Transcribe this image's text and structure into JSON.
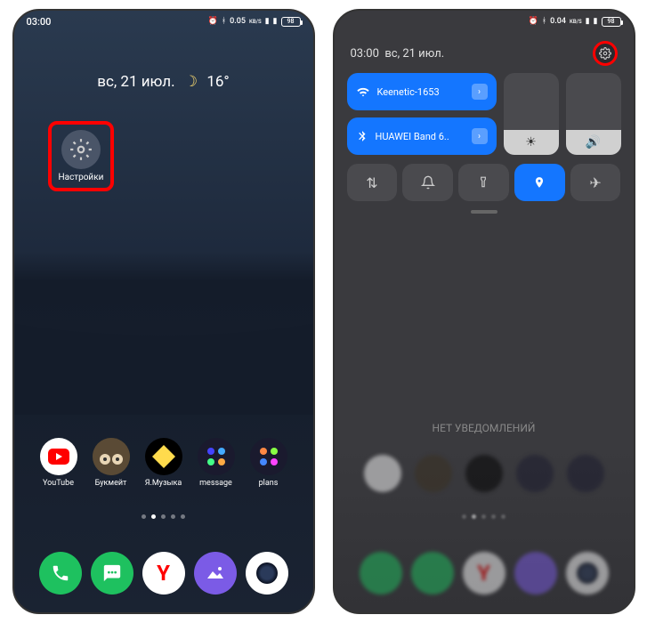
{
  "phone1": {
    "statusbar": {
      "time": "03:00",
      "net_speed": "0.05",
      "net_unit": "KB/S",
      "battery": "98"
    },
    "widget": {
      "date": "вс, 21 июл.",
      "temp": "16°"
    },
    "settings_app": {
      "label": "Настройки"
    },
    "apps": [
      {
        "label": "YouTube"
      },
      {
        "label": "Букмейт"
      },
      {
        "label": "Я.Музыка"
      },
      {
        "label": "message"
      },
      {
        "label": "plans"
      }
    ]
  },
  "phone2": {
    "statusbar": {
      "time": "03:00",
      "net_speed": "0.04",
      "net_unit": "KB/S",
      "battery": "98"
    },
    "header": {
      "time": "03:00",
      "date": "вс, 21 июл."
    },
    "wifi": {
      "name": "Keenetic-1653"
    },
    "bt": {
      "name": "HUAWEI Band 6.."
    },
    "no_notif": "НЕТ УВЕДОМЛЕНИЙ"
  }
}
